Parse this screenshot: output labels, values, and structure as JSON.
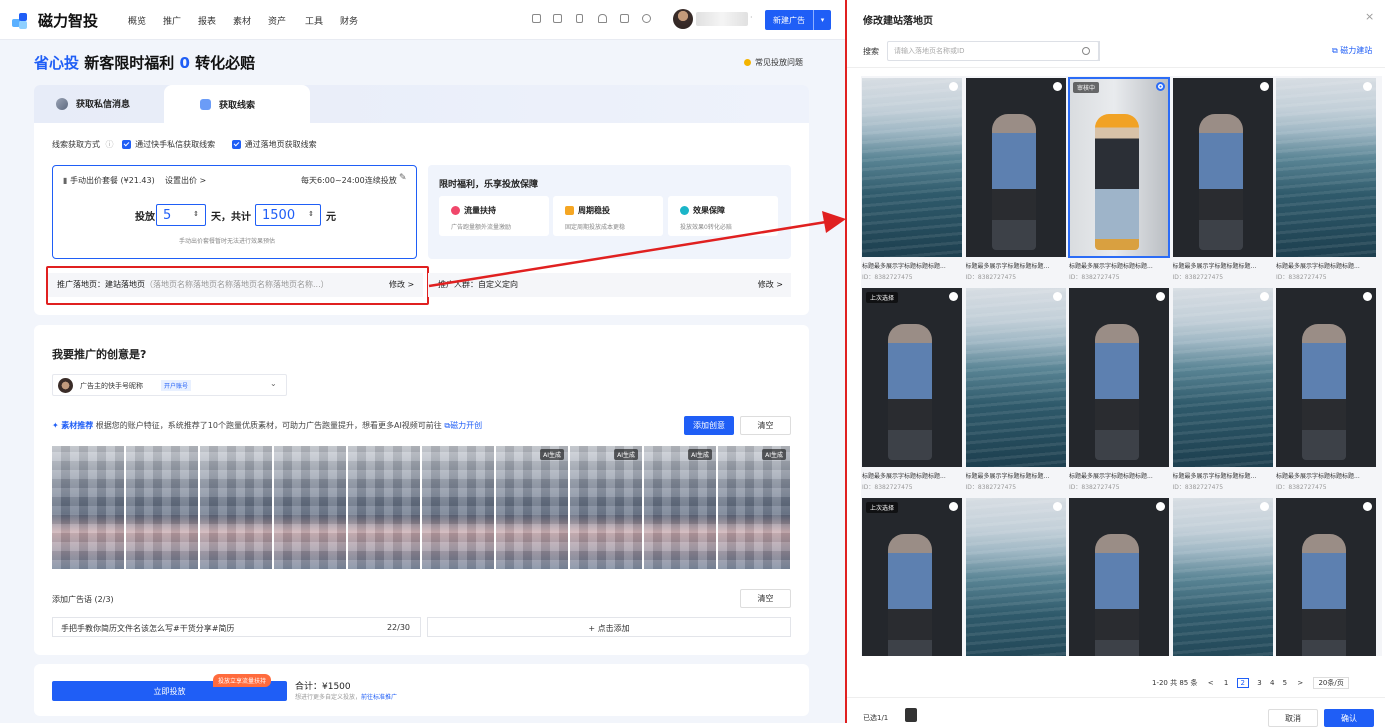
{
  "brand": {
    "name": "磁力智投"
  },
  "nav": [
    "概览",
    "推广",
    "报表",
    "素材",
    "资产",
    "工具",
    "财务"
  ],
  "toolbar": {
    "icons": [
      "box-icon",
      "tablet-icon",
      "phone-icon",
      "bell-icon",
      "mail-icon",
      "help-icon"
    ],
    "user_name": "",
    "new_ad_label": "新建广告",
    "new_ad_arrow": "▾"
  },
  "banner": {
    "brand": "省心投",
    "text_a": "新客限时福利",
    "number": "0",
    "text_b": "转化必赔",
    "faq": "常见投放问题"
  },
  "tabs": {
    "tab1": "获取私信消息",
    "tab2": "获取线索"
  },
  "lead": {
    "label": "线索获取方式",
    "opt1": "通过快手私信获取线索",
    "opt2": "通过落地页获取线索"
  },
  "bid": {
    "package": "手动出价套餐 (¥21.43)",
    "set_price": "设置出价 >",
    "schedule": "每天6:00~24:00连续投放",
    "days_label": "投放",
    "days": "5",
    "days_unit": "天，共计",
    "total": "1500",
    "currency": "元",
    "note": "手动出价套餐暂时无法进行效果预估"
  },
  "benefit": {
    "title": "限时福利，乐享投放保障",
    "items": [
      {
        "title": "流量扶持",
        "desc": "广告跑量额外流量激励",
        "color": "#f0476b"
      },
      {
        "title": "周期稳投",
        "desc": "固定周期投放成本更稳",
        "color": "#f5a623"
      },
      {
        "title": "效果保障",
        "desc": "投放效果0转化必赔",
        "color": "#1bb5c8"
      }
    ]
  },
  "landing": {
    "label": "推广落地页：建站落地页",
    "detail": "（落地页名称落地页名称落地页名称落地页名称...）",
    "edit": "修改 >"
  },
  "audience": {
    "label": "推广人群：自定义定向",
    "edit": "修改 >"
  },
  "creative": {
    "title": "我要推广的创意是?",
    "account": "广告主的快手号昵称",
    "account_tag": "开户账号",
    "rec_title": "素材推荐",
    "rec_desc": "根据您的账户特征，系统推荐了10个跑量优质素材，可助力广告跑量提升，想看更多AI视频可前往",
    "rec_link": "磁力开创",
    "add": "添加创意",
    "clear": "清空",
    "thumbs": [
      {
        "ai": ""
      },
      {
        "ai": ""
      },
      {
        "ai": ""
      },
      {
        "ai": ""
      },
      {
        "ai": ""
      },
      {
        "ai": ""
      },
      {
        "ai": "AI生成"
      },
      {
        "ai": "AI生成"
      },
      {
        "ai": "AI生成"
      },
      {
        "ai": "AI生成"
      }
    ]
  },
  "adcopy": {
    "title": "添加广告语 (2/3)",
    "clear": "清空",
    "text": "手把手教你简历文件名该怎么写#干货分享#简历",
    "count": "22/30",
    "add": "+ 点击添加"
  },
  "footer": {
    "submit": "立即投放",
    "badge": "投放立享流量扶持",
    "total": "合计：¥1500",
    "hint": "想进行更多自定义投放，",
    "hint_link": "前往标准推广"
  },
  "panel": {
    "title": "修改建站落地页",
    "close": "×",
    "search_label": "搜索",
    "search_placeholder": "请输入落地页名称或ID",
    "link": "磁力建站",
    "items": [
      {
        "img": "sea",
        "caption": "标题最多展示字标题标题标题...",
        "id": "ID：8382727475",
        "tag": ""
      },
      {
        "img": "person",
        "caption": "标题最多展示字标题标题标题...",
        "id": "ID：8382727475",
        "tag": ""
      },
      {
        "img": "person2",
        "caption": "标题最多展示字标题标题标题...",
        "id": "ID：8382727475",
        "tag": "审核中",
        "selected": true
      },
      {
        "img": "person",
        "caption": "标题最多展示字标题标题标题...",
        "id": "ID：8382727475",
        "tag": ""
      },
      {
        "img": "sea",
        "caption": "标题最多展示字标题标题标题...",
        "id": "ID：8382727475",
        "tag": ""
      },
      {
        "img": "person",
        "caption": "标题最多展示字标题标题标题...",
        "id": "ID：8382727475",
        "tag": "上次选择"
      },
      {
        "img": "sea",
        "caption": "标题最多展示字标题标题标题...",
        "id": "ID：8382727475",
        "tag": ""
      },
      {
        "img": "person",
        "caption": "标题最多展示字标题标题标题...",
        "id": "ID：8382727475",
        "tag": ""
      },
      {
        "img": "sea",
        "caption": "标题最多展示字标题标题标题...",
        "id": "ID：8382727475",
        "tag": ""
      },
      {
        "img": "person",
        "caption": "标题最多展示字标题标题标题...",
        "id": "ID：8382727475",
        "tag": ""
      },
      {
        "img": "person",
        "caption": "",
        "id": "",
        "tag": "上次选择"
      },
      {
        "img": "sea",
        "caption": "",
        "id": "",
        "tag": ""
      },
      {
        "img": "person",
        "caption": "",
        "id": "",
        "tag": ""
      },
      {
        "img": "sea",
        "caption": "",
        "id": "",
        "tag": ""
      },
      {
        "img": "person",
        "caption": "",
        "id": "",
        "tag": ""
      }
    ],
    "pager": {
      "total": "1-20 共 85 条",
      "prev": "<",
      "pages": [
        "1",
        "2",
        "3",
        "4",
        "5"
      ],
      "current": "2",
      "next": ">",
      "size": "20条/页"
    },
    "selected_count": "已选1/1",
    "cancel": "取消",
    "confirm": "确认"
  }
}
